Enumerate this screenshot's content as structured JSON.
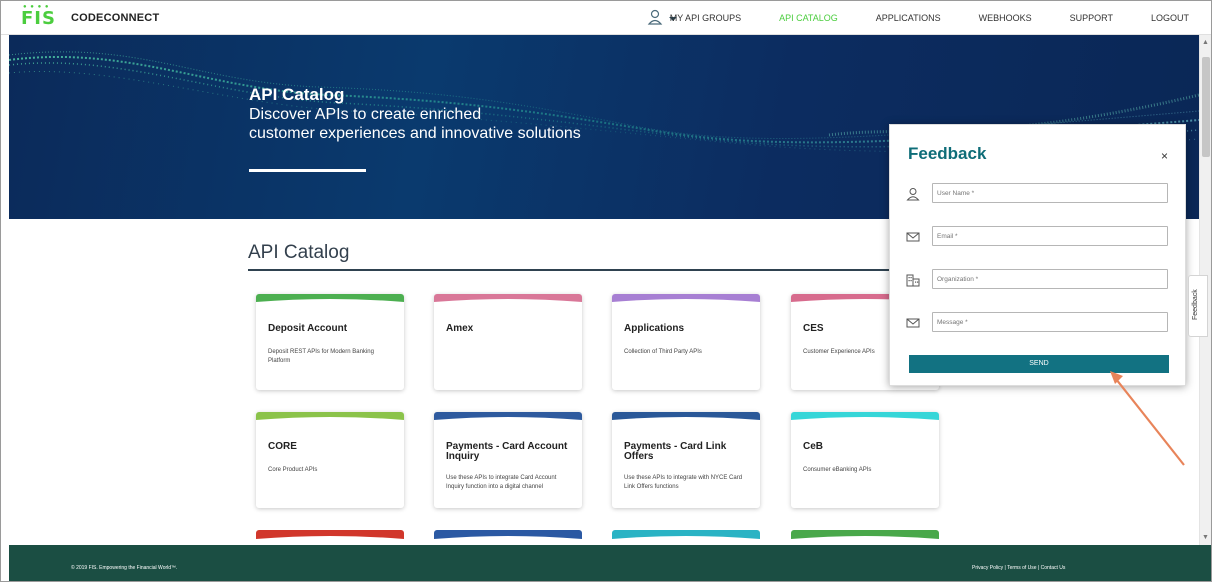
{
  "app": {
    "logo_text": "FIS",
    "brand": "CODECONNECT"
  },
  "nav": {
    "items": [
      {
        "label": "MY API GROUPS",
        "active": false
      },
      {
        "label": "API CATALOG",
        "active": true
      },
      {
        "label": "APPLICATIONS",
        "active": false
      },
      {
        "label": "WEBHOOKS",
        "active": false
      },
      {
        "label": "SUPPORT",
        "active": false
      },
      {
        "label": "LOGOUT",
        "active": false
      }
    ],
    "user_icon": "user-icon"
  },
  "hero": {
    "title": "API Catalog",
    "subtitle_line1": "Discover APIs to create enriched",
    "subtitle_line2": "customer experiences and innovative solutions"
  },
  "catalog": {
    "title": "API Catalog",
    "cards": [
      {
        "title": "Deposit Account",
        "desc": "Deposit REST APIs for Modern Banking Platform",
        "color": "#4caf50"
      },
      {
        "title": "Amex",
        "desc": "",
        "color": "#d97798"
      },
      {
        "title": "Applications",
        "desc": "Collection of Third Party APIs",
        "color": "#a77fd3"
      },
      {
        "title": "CES",
        "desc": "Customer Experience APIs",
        "color": "#d76b8d"
      },
      {
        "title": "CORE",
        "desc": "Core Product APIs",
        "color": "#8bc34a"
      },
      {
        "title": "Payments - Card Account Inquiry",
        "desc": "Use these APIs to integrate Card Account Inquiry function into a digital channel",
        "color": "#2e5a9e"
      },
      {
        "title": "Payments - Card Link Offers",
        "desc": "Use these APIs to integrate with NYCE Card Link Offers functions",
        "color": "#2a5898"
      },
      {
        "title": "CeB",
        "desc": "Consumer eBanking APIs",
        "color": "#36d6d8"
      }
    ],
    "stub_colors": [
      "#d1372b",
      "#2b59a3",
      "#2ab3c4",
      "#49a84a"
    ]
  },
  "feedback": {
    "title": "Feedback",
    "close": "×",
    "fields": [
      {
        "placeholder": "User Name *",
        "icon": "user-icon"
      },
      {
        "placeholder": "Email *",
        "icon": "envelope-icon"
      },
      {
        "placeholder": "Organization *",
        "icon": "building-icon"
      },
      {
        "placeholder": "Message *",
        "icon": "envelope-icon"
      }
    ],
    "send_label": "SEND",
    "tab_label": "Feedback"
  },
  "footer": {
    "copyright": "© 2019 FIS. Empowering the Financial World™.",
    "links": "Privacy Policy | Terms of Use | Contact Us"
  },
  "colors": {
    "accent_green": "#4bcd3e",
    "teal": "#127282",
    "footer": "#1b4e43",
    "hero": "#0b2a5a",
    "arrow": "#e8845a"
  }
}
